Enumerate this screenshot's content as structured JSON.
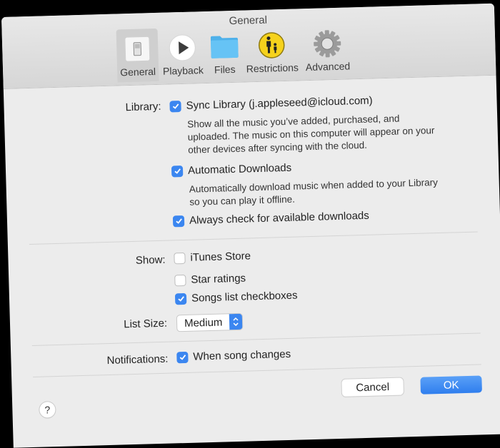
{
  "window": {
    "title": "General"
  },
  "toolbar": {
    "items": [
      {
        "label": "General",
        "icon": "general-switch-icon",
        "active": true
      },
      {
        "label": "Playback",
        "icon": "play-icon",
        "active": false
      },
      {
        "label": "Files",
        "icon": "folder-icon",
        "active": false
      },
      {
        "label": "Restrictions",
        "icon": "parental-restrictions-icon",
        "active": false
      },
      {
        "label": "Advanced",
        "icon": "gear-icon",
        "active": false
      }
    ]
  },
  "library": {
    "label": "Library:",
    "sync": {
      "label": "Sync Library (j.appleseed@icloud.com)",
      "checked": true,
      "description": "Show all the music you’ve added, purchased, and uploaded. The music on this computer will appear on your other devices after syncing with the cloud."
    },
    "auto_downloads": {
      "label": "Automatic Downloads",
      "checked": true,
      "description": "Automatically download music when added to your Library so you can play it offline."
    },
    "always_check": {
      "label": "Always check for available downloads",
      "checked": true
    }
  },
  "show": {
    "label": "Show:",
    "itunes_store": {
      "label": "iTunes Store",
      "checked": false
    },
    "star_ratings": {
      "label": "Star ratings",
      "checked": false
    },
    "songs_checkboxes": {
      "label": "Songs list checkboxes",
      "checked": true
    }
  },
  "list_size": {
    "label": "List Size:",
    "value": "Medium"
  },
  "notifications": {
    "label": "Notifications:",
    "song_changes": {
      "label": "When song changes",
      "checked": true
    }
  },
  "footer": {
    "help": "?",
    "cancel": "Cancel",
    "ok": "OK"
  },
  "colors": {
    "accent": "#3b86f0",
    "window_bg": "#ececec"
  }
}
